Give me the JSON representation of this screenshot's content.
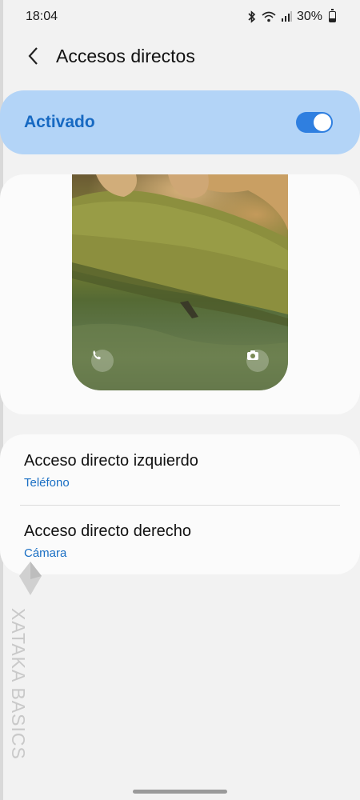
{
  "status_bar": {
    "time": "18:04",
    "battery": "30%",
    "battery_level": 0.3,
    "icons": [
      "bluetooth-icon",
      "wifi-icon",
      "signal-icon",
      "battery-icon"
    ]
  },
  "header": {
    "title": "Accesos directos",
    "back_icon": "back-arrow-icon"
  },
  "master_toggle": {
    "label": "Activado",
    "on": true,
    "accent": "#1769c2",
    "background": "#b3d4f7"
  },
  "preview": {
    "left_shortcut_icon": "phone-icon",
    "right_shortcut_icon": "camera-icon"
  },
  "settings": [
    {
      "title": "Acceso directo izquierdo",
      "value": "Teléfono"
    },
    {
      "title": "Acceso directo derecho",
      "value": "Cámara"
    }
  ],
  "watermark": {
    "text": "XATAKA BASICS"
  },
  "colors": {
    "background": "#f2f2f2",
    "card": "#fbfbfb",
    "link": "#1a6fc4",
    "switch_on": "#2f7fe0"
  }
}
